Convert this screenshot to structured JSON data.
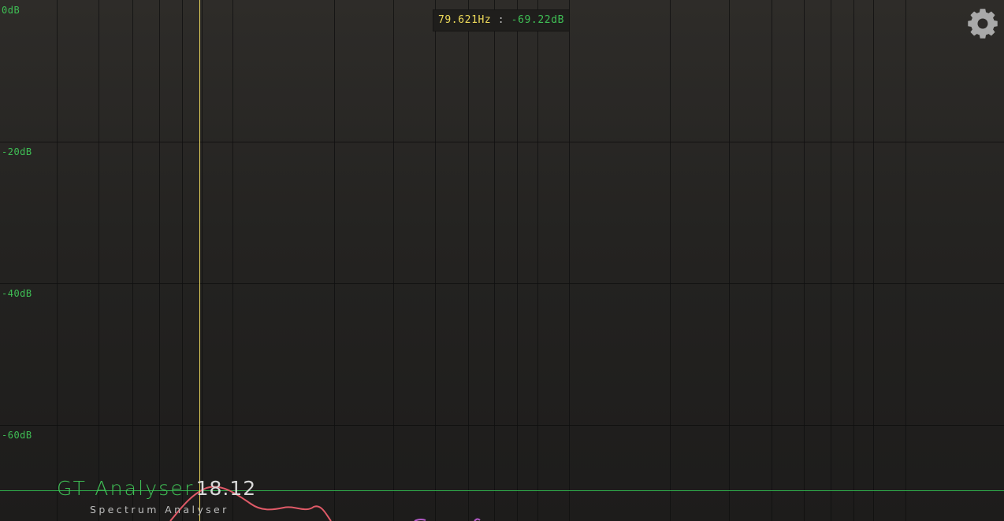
{
  "colors": {
    "db_label": "#3fbf55",
    "cursor_line": "#e6d25a",
    "readout_freq": "#f0dc5a",
    "readout_sep": "#bdbdbd",
    "readout_db": "#3fbf55",
    "threshold_line": "#2fae4c",
    "spectrum_curve": "#e05a68",
    "spectrum_curve_alt": "#b35ac8",
    "brand_name": "#3fbf55",
    "brand_version": "#d8d8d8",
    "brand_sub": "#bdbdbd",
    "gear": "#a9a9a9",
    "grid": "#0f0f0f"
  },
  "axis": {
    "db_labels": [
      "0dB",
      "-20dB",
      "-40dB",
      "-60dB"
    ]
  },
  "readout": {
    "frequency": "79.621Hz",
    "separator": " : ",
    "level": "-69.22dB"
  },
  "settings": {
    "icon": "gear-icon"
  },
  "brand": {
    "name": "GT Analyser",
    "version": "18.12",
    "subtitle": "Spectrum Analyser"
  }
}
